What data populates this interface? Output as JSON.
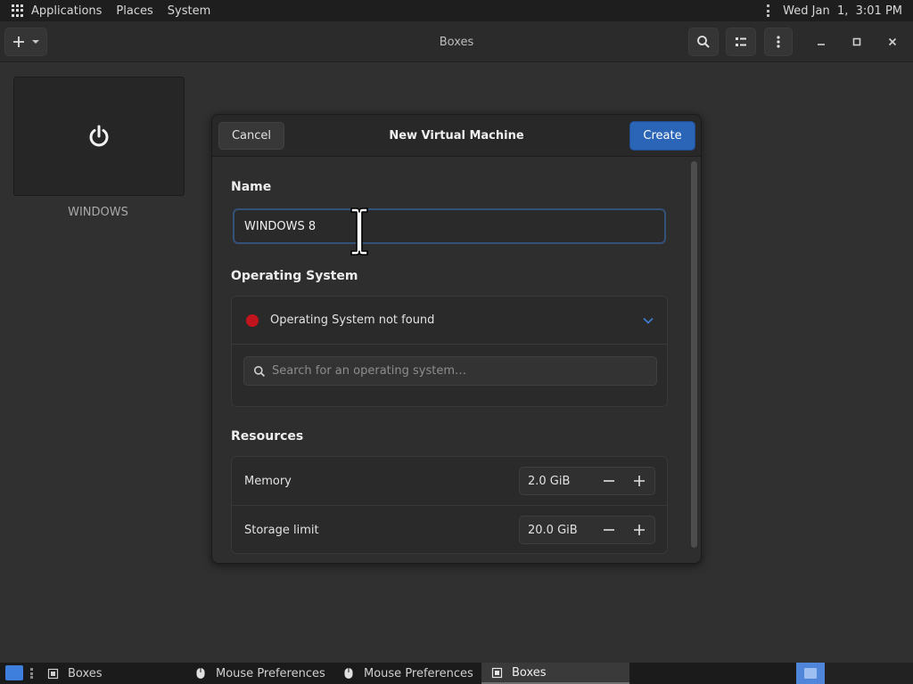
{
  "top_panel": {
    "menus": [
      "Applications",
      "Places",
      "System"
    ],
    "clock": "Wed Jan  1,  3:01 PM"
  },
  "headerbar": {
    "title": "Boxes",
    "add_icon": "plus-icon",
    "search_icon": "search-icon",
    "view_icon": "list-view-icon",
    "menu_icon": "kebab-menu-icon"
  },
  "machines": [
    {
      "label": "WINDOWS",
      "icon": "power-icon"
    }
  ],
  "dialog": {
    "title": "New Virtual Machine",
    "cancel_label": "Cancel",
    "create_label": "Create",
    "name_label": "Name",
    "name_value": "WINDOWS 8",
    "os_label": "Operating System",
    "os_status": "Operating System not found",
    "os_status_color": "#c2141c",
    "os_search_placeholder": "Search for an operating system…",
    "resources_label": "Resources",
    "memory_label": "Memory",
    "memory_value": "2.0 GiB",
    "storage_label": "Storage limit",
    "storage_value": "20.0 GiB"
  },
  "taskbar": {
    "tasks": [
      {
        "label": "Boxes",
        "icon": "boxes-app-icon"
      },
      {
        "label": "Mouse Preferences",
        "icon": "mouse-icon"
      },
      {
        "label": "Mouse Preferences",
        "icon": "mouse-icon"
      },
      {
        "label": "Boxes",
        "icon": "boxes-app-icon",
        "active": true
      }
    ]
  },
  "colors": {
    "accent": "#2b65b8",
    "workspace_active": "#4f86d9"
  }
}
